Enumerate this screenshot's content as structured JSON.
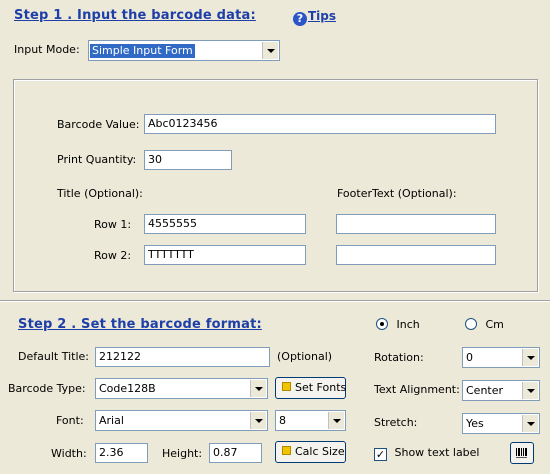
{
  "step1": {
    "title": "Step 1 .  Input the barcode data:",
    "tips_label": "Tips",
    "input_mode_label": "Input Mode:",
    "input_mode_value": "Simple Input Form",
    "barcode_value_label": "Barcode Value:",
    "barcode_value": "Abc0123456",
    "print_quantity_label": "Print Quantity:",
    "print_quantity": "30",
    "title_optional_label": "Title (Optional):",
    "footer_optional_label": "FooterText (Optional):",
    "row1_label": "Row 1:",
    "row1_value": "4555555",
    "row2_label": "Row 2:",
    "row2_value": "TTTTTTT",
    "footer_row1_value": "",
    "footer_row2_value": ""
  },
  "step2": {
    "title": "Step 2 .  Set the barcode format:",
    "unit_inch_label": "Inch",
    "unit_cm_label": "Cm",
    "default_title_label": "Default Title:",
    "default_title_value": "212122",
    "optional_label": "(Optional)",
    "barcode_type_label": "Barcode Type:",
    "barcode_type_value": "Code128B",
    "set_fonts_label": "Set Fonts",
    "font_label": "Font:",
    "font_value": "Arial",
    "font_size_value": "8",
    "width_label": "Width:",
    "width_value": "2.36",
    "height_label": "Height:",
    "height_value": "0.87",
    "calc_size_label": "Calc Size",
    "rotation_label": "Rotation:",
    "rotation_value": "0",
    "text_alignment_label": "Text Alignment:",
    "text_alignment_value": "Center",
    "stretch_label": "Stretch:",
    "stretch_value": "Yes",
    "show_text_label": "Show text label"
  },
  "colors": {
    "accent": "#1F3FA8",
    "background": "#ECE9D8",
    "selection": "#316AC5"
  },
  "icons": {
    "tips": "help-circle-icon",
    "barcode": "barcode-icon"
  }
}
